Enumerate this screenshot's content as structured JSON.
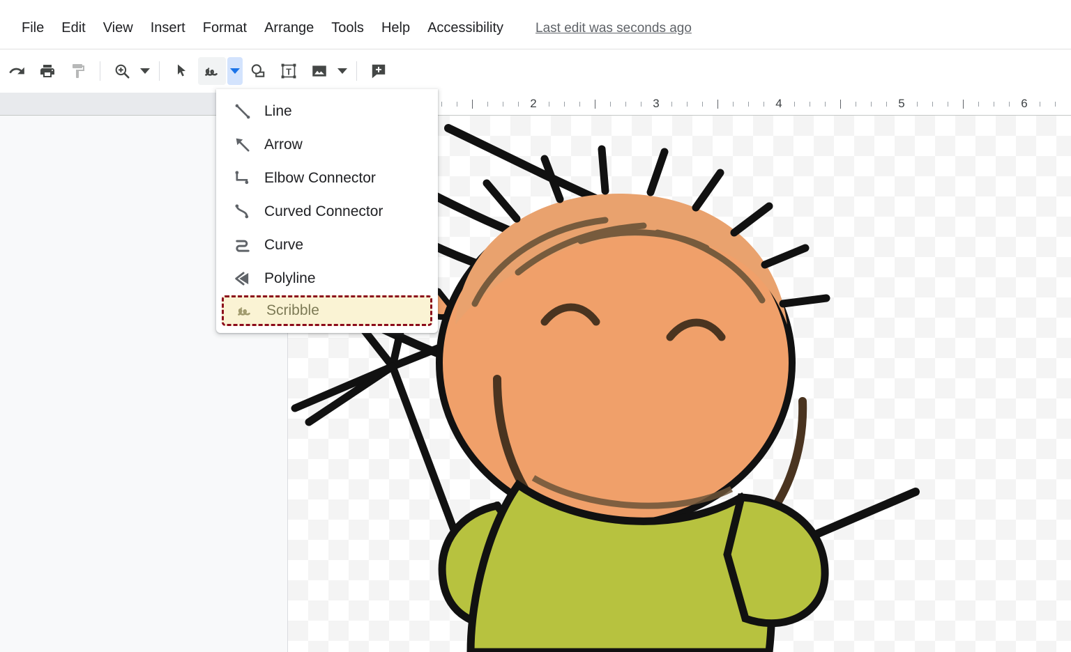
{
  "app": {
    "partial_title_row": "· · · · · · · · · · ·"
  },
  "menubar": {
    "items": [
      {
        "label": "File",
        "name": "menu-file"
      },
      {
        "label": "Edit",
        "name": "menu-edit"
      },
      {
        "label": "View",
        "name": "menu-view"
      },
      {
        "label": "Insert",
        "name": "menu-insert"
      },
      {
        "label": "Format",
        "name": "menu-format"
      },
      {
        "label": "Arrange",
        "name": "menu-arrange"
      },
      {
        "label": "Tools",
        "name": "menu-tools"
      },
      {
        "label": "Help",
        "name": "menu-help"
      },
      {
        "label": "Accessibility",
        "name": "menu-accessibility"
      }
    ],
    "last_edit": "Last edit was seconds ago"
  },
  "toolbar": {
    "buttons": [
      {
        "icon": "redo-icon",
        "label": "Redo"
      },
      {
        "icon": "print-icon",
        "label": "Print"
      },
      {
        "icon": "paint-format-icon",
        "label": "Paint format"
      },
      {
        "icon": "zoom-icon",
        "label": "Zoom"
      },
      {
        "icon": "select-icon",
        "label": "Select"
      },
      {
        "icon": "line-tool-icon",
        "label": "Line"
      },
      {
        "icon": "shape-icon",
        "label": "Shape"
      },
      {
        "icon": "text-box-icon",
        "label": "Text box"
      },
      {
        "icon": "image-icon",
        "label": "Image"
      },
      {
        "icon": "comment-icon",
        "label": "Add comment"
      }
    ]
  },
  "ruler": {
    "numbers": [
      "2",
      "3",
      "4",
      "5",
      "6"
    ],
    "unit": "inches"
  },
  "line_menu": {
    "items": [
      {
        "label": "Line",
        "icon": "line-icon",
        "highlighted": false
      },
      {
        "label": "Arrow",
        "icon": "arrow-icon",
        "highlighted": false
      },
      {
        "label": "Elbow Connector",
        "icon": "elbow-connector-icon",
        "highlighted": false
      },
      {
        "label": "Curved Connector",
        "icon": "curved-connector-icon",
        "highlighted": false
      },
      {
        "label": "Curve",
        "icon": "curve-icon",
        "highlighted": false
      },
      {
        "label": "Polyline",
        "icon": "polyline-icon",
        "highlighted": false
      },
      {
        "label": "Scribble",
        "icon": "scribble-icon",
        "highlighted": true
      }
    ]
  },
  "canvas": {
    "artwork_description": "Cartoon child waving, olive-green shirt, orange-tan skin",
    "background": "transparent-checkerboard"
  },
  "colors": {
    "highlight_fill": "#faf3d4",
    "highlight_border": "#8b0a1a",
    "accent_blue": "#1a73e8",
    "dropdown_active_bg": "#d3e3fd",
    "skin": "#f0a06a",
    "shirt": "#b7c23f",
    "outline": "#111111",
    "text": "#202124",
    "muted_text": "#5f6368"
  }
}
